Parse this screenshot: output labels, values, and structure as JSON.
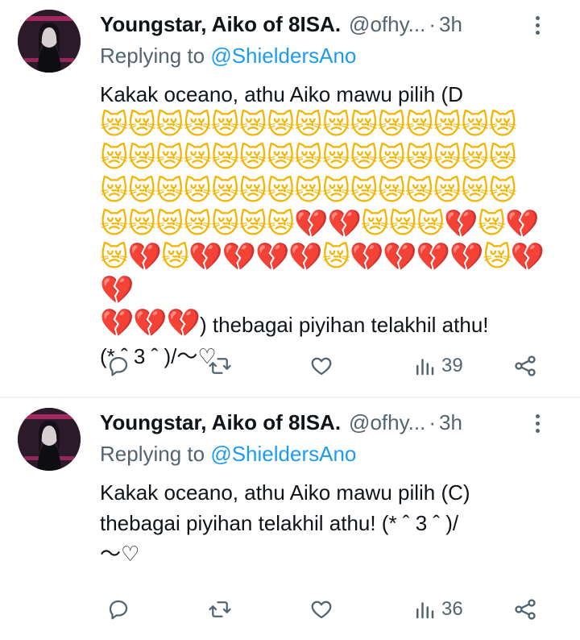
{
  "tweets": [
    {
      "author": {
        "display_name": "Youngstar, Aiko of 8ISA.",
        "handle": "@ofhy...",
        "separator": "·",
        "time": "3h"
      },
      "reply": {
        "prefix": "Replying to ",
        "mention": "@ShieldersAno"
      },
      "text_lines": [
        "Kakak oceano, athu Aiko mawu pilih (D"
      ],
      "emoji_rows": [
        [
          "cat",
          "cat",
          "cat",
          "cat",
          "cat",
          "cat",
          "cat",
          "cat",
          "cat",
          "cat",
          "cat",
          "cat",
          "cat",
          "cat",
          "cat"
        ],
        [
          "cat",
          "cat",
          "cat",
          "cat",
          "cat",
          "cat",
          "cat",
          "cat",
          "cat",
          "cat",
          "cat",
          "cat",
          "cat",
          "cat",
          "cat"
        ],
        [
          "cat",
          "cat",
          "cat",
          "cat",
          "cat",
          "cat",
          "cat",
          "cat",
          "cat",
          "cat",
          "cat",
          "cat",
          "cat",
          "cat",
          "cat"
        ],
        [
          "cat",
          "cat",
          "cat",
          "cat",
          "cat",
          "cat",
          "cat",
          "heart",
          "heart",
          "cat",
          "cat",
          "cat",
          "heart",
          "cat",
          "heart"
        ],
        [
          "cat",
          "heart",
          "cat",
          "heart",
          "heart",
          "heart",
          "heart",
          "cat",
          "heart",
          "heart",
          "heart",
          "heart",
          "cat",
          "heart",
          "heart"
        ]
      ],
      "tail_emojis": [
        "heart",
        "heart",
        "heart"
      ],
      "tail_text": ") thebagai piyihan telakhil athu!",
      "last_line": "(* ˆ 3 ˆ )/〜♡",
      "stats": {
        "views": "39"
      }
    },
    {
      "author": {
        "display_name": "Youngstar, Aiko of 8ISA.",
        "handle": "@ofhy...",
        "separator": "·",
        "time": "3h"
      },
      "reply": {
        "prefix": "Replying to ",
        "mention": "@ShieldersAno"
      },
      "text_lines": [
        "Kakak oceano, athu Aiko mawu pilih (C)",
        "thebagai piyihan telakhil athu! (* ˆ 3 ˆ )/",
        "〜♡"
      ],
      "stats": {
        "views": "36"
      }
    }
  ],
  "emoji_glyphs": {
    "cat": "😿",
    "heart": "💔"
  },
  "colors": {
    "link": "#1d9bf0",
    "muted": "#536471",
    "text": "#0f1419",
    "divider": "#eff3f4"
  }
}
